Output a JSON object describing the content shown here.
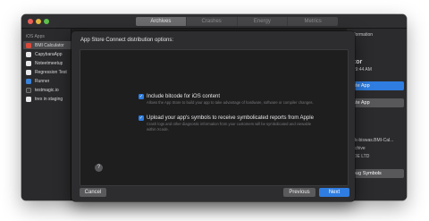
{
  "organizer": {
    "tabs": [
      {
        "label": "Archives",
        "active": true
      },
      {
        "label": "Crashes",
        "active": false
      },
      {
        "label": "Energy",
        "active": false
      },
      {
        "label": "Metrics",
        "active": false
      }
    ],
    "sidebar": {
      "heading": "iOS Apps",
      "items": [
        {
          "label": "BMI Calculator",
          "icon": "red",
          "selected": true
        },
        {
          "label": "CapybaraApp",
          "icon": "white",
          "selected": false
        },
        {
          "label": "Noteetmeetup",
          "icon": "white",
          "selected": false
        },
        {
          "label": "Regression Test",
          "icon": "white",
          "selected": false
        },
        {
          "label": "Runner",
          "icon": "blue",
          "selected": false
        },
        {
          "label": "testmagic.io",
          "icon": "dark",
          "selected": false
        },
        {
          "label": "trex in staging",
          "icon": "white",
          "selected": false
        }
      ]
    },
    "right_panel": {
      "section": "Information",
      "header_partial": "ator",
      "date_partial": "at 9:44 AM",
      "distribute_button": "ute App",
      "validate_button": "ate App",
      "identifier_partial": "rvik-biswas.BMI-Cal...",
      "type": "Archive",
      "team_partial": "ODE LTD",
      "symbols_button": "bug Symbols"
    }
  },
  "sheet": {
    "title": "App Store Connect distribution options:",
    "options": [
      {
        "checked": true,
        "label": "Include bitcode for iOS content",
        "description": "Allows the App Store to build your app to take advantage of hardware, software or compiler changes."
      },
      {
        "checked": true,
        "label": "Upload your app's symbols to receive symbolicated reports from Apple",
        "description": "Crash logs and other diagnostic information from your customers will be symbolicated and viewable within Xcode."
      }
    ],
    "help": "?",
    "buttons": {
      "cancel": "Cancel",
      "previous": "Previous",
      "next": "Next"
    }
  },
  "colors": {
    "accent": "#2f7de1",
    "window_bg": "#1f1f20",
    "sheet_bg": "#2d2d2f"
  }
}
